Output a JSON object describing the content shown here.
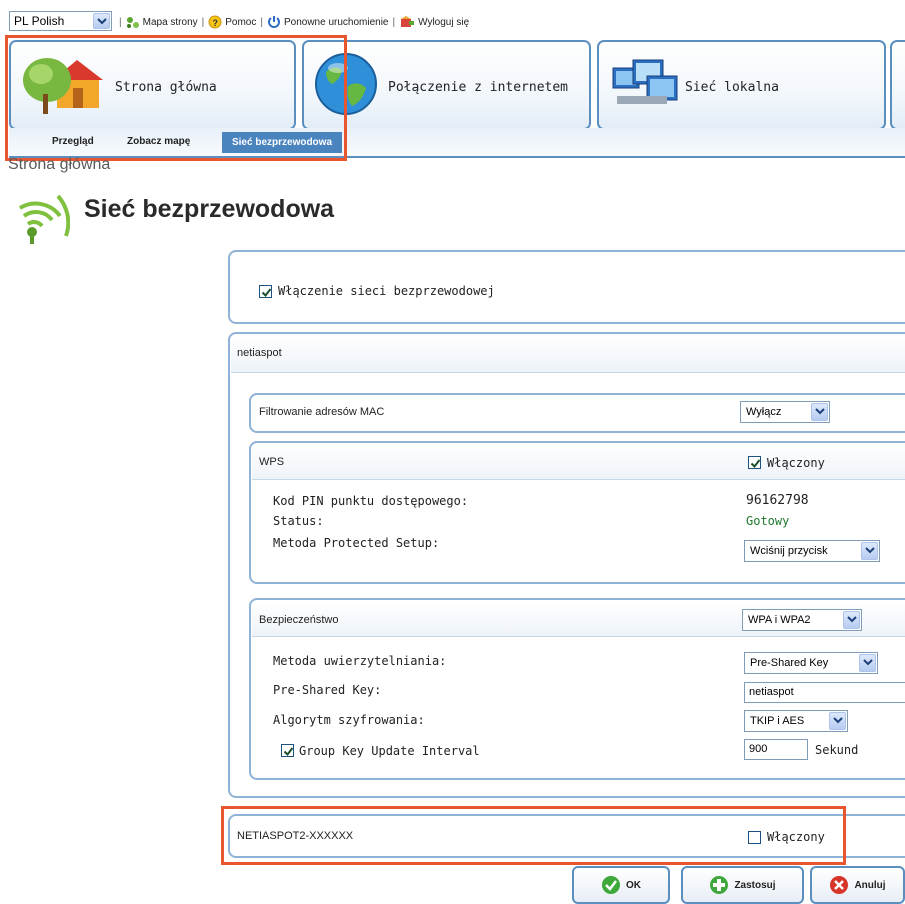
{
  "topbar": {
    "language": "PL Polish",
    "links": [
      "Mapa strony",
      "Pomoc",
      "Ponowne uruchomienie",
      "Wyloguj się"
    ]
  },
  "nav": {
    "tabs": [
      "Strona główna",
      "Połączenie z internetem",
      "Sieć lokalna"
    ],
    "subtabs": [
      "Przegląd",
      "Zobacz mapę",
      "Sieć bezprzewodowa"
    ]
  },
  "page": {
    "breadcrumb": "Strona główna",
    "title": "Sieć bezprzewodowa"
  },
  "wireless": {
    "enable_label": "Włączenie sieci bezprzewodowej",
    "enabled": true
  },
  "network1": {
    "ssid": "netiaspot",
    "mac_filter": {
      "label": "Filtrowanie adresów MAC",
      "value": "Wyłącz"
    },
    "wps": {
      "label": "WPS",
      "enabled_label": "Włączony",
      "enabled": true,
      "pin_label": "Kod PIN punktu dostępowego:",
      "pin_value": "96162798",
      "status_label": "Status:",
      "status_value": "Gotowy",
      "method_label": "Metoda Protected Setup:",
      "method_value": "Wciśnij przycisk"
    },
    "security": {
      "label": "Bezpieczeństwo",
      "value": "WPA i WPA2",
      "auth_label": "Metoda uwierzytelniania:",
      "auth_value": "Pre-Shared Key",
      "psk_label": "Pre-Shared Key:",
      "psk_value": "netiaspot",
      "cipher_label": "Algorytm szyfrowania:",
      "cipher_value": "TKIP i AES",
      "gkui_label": "Group Key Update Interval",
      "gkui_checked": true,
      "gkui_value": "900",
      "gkui_unit": "Sekund"
    }
  },
  "network2": {
    "ssid": "NETIASPOT2-XXXXXX",
    "enabled_label": "Włączony",
    "enabled": false
  },
  "buttons": {
    "ok": "OK",
    "apply": "Zastosuj",
    "cancel": "Anuluj"
  },
  "colors": {
    "accent": "#4a84bf",
    "border": "#5b8fc0",
    "highlight": "#e8552f"
  }
}
